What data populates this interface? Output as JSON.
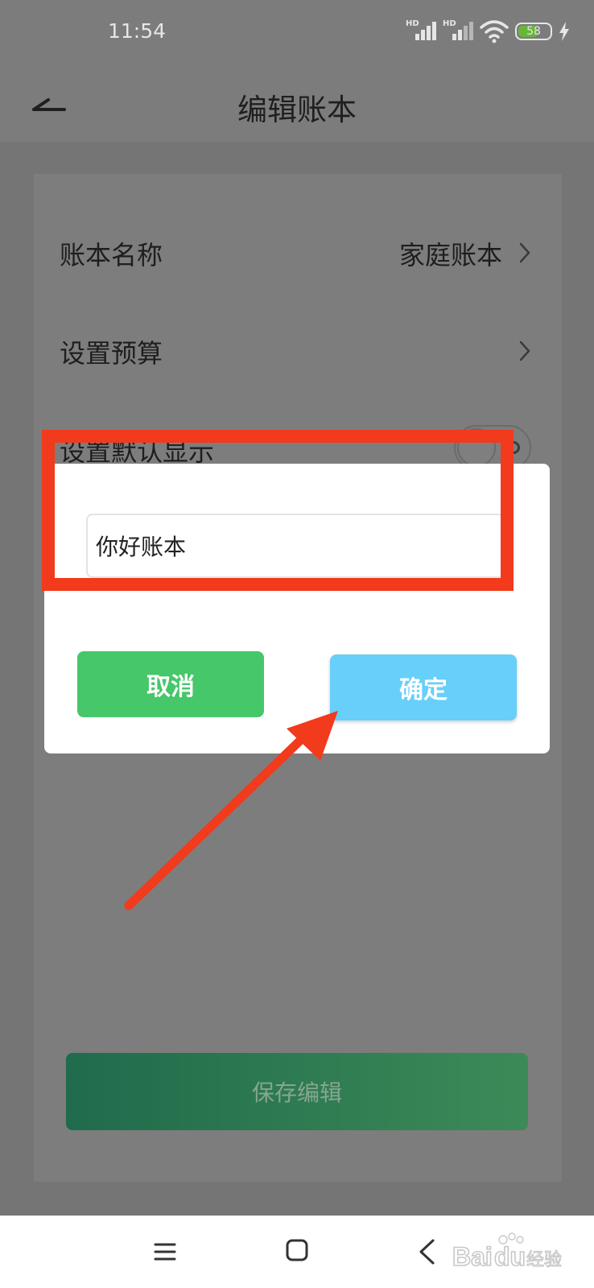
{
  "status_bar": {
    "time": "11:54",
    "sim1_label": "HD",
    "sim2_label": "HD",
    "battery_level": "58",
    "icons": [
      "signal-icon",
      "signal-icon",
      "wifi-icon",
      "battery-icon",
      "charging-icon"
    ]
  },
  "header": {
    "title": "编辑账本",
    "back_icon": "back-arrow-icon"
  },
  "settings": {
    "rows": [
      {
        "label": "账本名称",
        "value": "家庭账本"
      },
      {
        "label": "设置预算",
        "value": ""
      },
      {
        "label": "设置默认显示",
        "toggle_on": false
      }
    ],
    "save_label": "保存编辑"
  },
  "dialog": {
    "input_value": "你好账本",
    "cancel_label": "取消",
    "confirm_label": "确定"
  },
  "annotation": {
    "color": "#f23a1c"
  },
  "colors": {
    "cancel": "#46c76a",
    "confirm": "#67cffa",
    "save_gradient_start": "#1f6b4c",
    "save_gradient_end": "#3d8a58"
  },
  "nav_bar": {
    "icons": [
      "menu-icon",
      "home-icon",
      "back-icon"
    ]
  },
  "watermark": {
    "text": "Baidu经验"
  }
}
